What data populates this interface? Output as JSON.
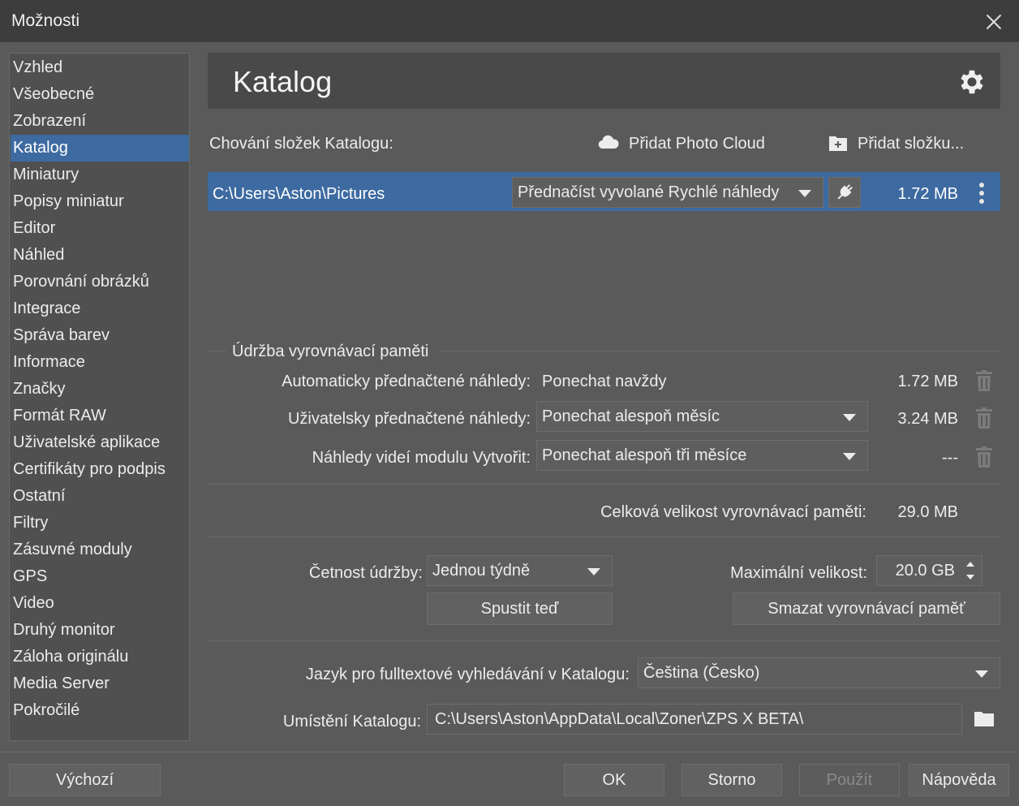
{
  "window": {
    "title": "Možnosti"
  },
  "sidebar": {
    "items": [
      {
        "label": "Vzhled"
      },
      {
        "label": "Všeobecné"
      },
      {
        "label": "Zobrazení"
      },
      {
        "label": "Katalog",
        "active": true
      },
      {
        "label": "Miniatury"
      },
      {
        "label": "Popisy miniatur"
      },
      {
        "label": "Editor"
      },
      {
        "label": "Náhled"
      },
      {
        "label": "Porovnání obrázků"
      },
      {
        "label": "Integrace"
      },
      {
        "label": "Správa barev"
      },
      {
        "label": "Informace"
      },
      {
        "label": "Značky"
      },
      {
        "label": "Formát RAW"
      },
      {
        "label": "Uživatelské aplikace"
      },
      {
        "label": "Certifikáty pro podpis"
      },
      {
        "label": "Ostatní"
      },
      {
        "label": "Filtry"
      },
      {
        "label": "Zásuvné moduly"
      },
      {
        "label": "GPS"
      },
      {
        "label": "Video"
      },
      {
        "label": "Druhý monitor"
      },
      {
        "label": "Záloha originálu"
      },
      {
        "label": "Media Server"
      },
      {
        "label": "Pokročilé"
      }
    ]
  },
  "header": {
    "title": "Katalog"
  },
  "folders": {
    "label": "Chování složek Katalogu:",
    "add_cloud": "Přidat Photo Cloud",
    "add_folder": "Přidat složku...",
    "rows": [
      {
        "path": "C:\\Users\\Aston\\Pictures",
        "mode": "Přednačíst vyvolané Rychlé náhledy",
        "size": "1.72 MB"
      }
    ]
  },
  "cache": {
    "section_title": "Údržba vyrovnávací paměti",
    "auto_label": "Automaticky přednačtené náhledy:",
    "auto_value": "Ponechat navždy",
    "auto_size": "1.72 MB",
    "user_label": "Uživatelsky přednačtené náhledy:",
    "user_value": "Ponechat alespoň měsíc",
    "user_size": "3.24 MB",
    "video_label": "Náhledy videí modulu Vytvořit:",
    "video_value": "Ponechat alespoň tři měsíce",
    "video_size": "---",
    "total_label": "Celková velikost vyrovnávací paměti:",
    "total_value": "29.0 MB",
    "freq_label": "Četnost údržby:",
    "freq_value": "Jednou týdně",
    "max_label": "Maximální velikost:",
    "max_value": "20.0 GB",
    "run_now": "Spustit teď",
    "clear": "Smazat vyrovnávací paměť"
  },
  "search": {
    "lang_label": "Jazyk pro fulltextové vyhledávání v Katalogu:",
    "lang_value": "Čeština (Česko)",
    "location_label": "Umístění Katalogu:",
    "location_value": "C:\\Users\\Aston\\AppData\\Local\\Zoner\\ZPS X BETA\\"
  },
  "footer": {
    "default": "Výchozí",
    "ok": "OK",
    "cancel": "Storno",
    "apply": "Použít",
    "help": "Nápověda"
  },
  "icons": {
    "close": "close-icon",
    "gear": "gear-icon",
    "cloud": "cloud-icon",
    "add_folder": "folder-plus-icon",
    "plug": "plug-icon",
    "kebab": "more-vertical-icon",
    "trash": "trash-icon",
    "folder": "folder-icon"
  }
}
